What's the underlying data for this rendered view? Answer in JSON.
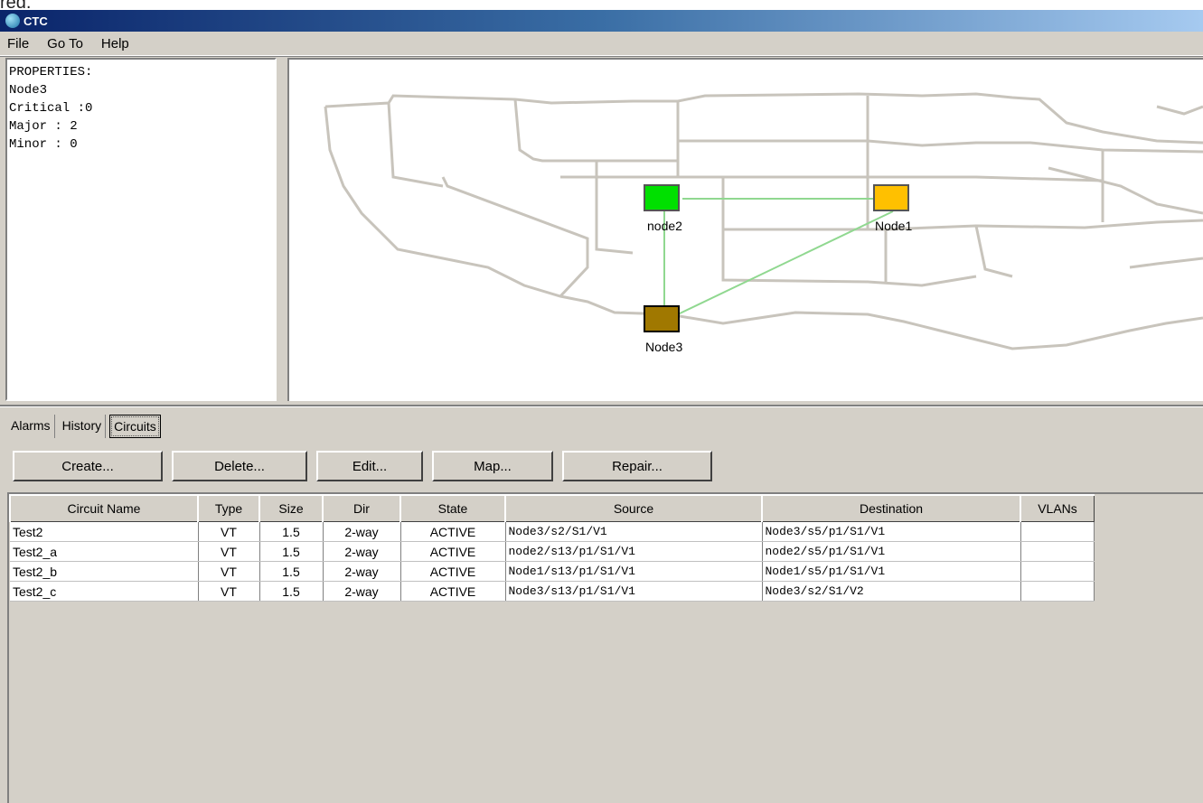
{
  "window": {
    "title": "CTC"
  },
  "top_fragment": "red.",
  "menu": [
    "File",
    "Go To",
    "Help"
  ],
  "properties": {
    "lines": [
      "PROPERTIES:",
      "Node3",
      "Critical :0",
      "Major : 2",
      "Minor : 0"
    ]
  },
  "map": {
    "nodes": [
      {
        "label": "node2",
        "color": "#00e000"
      },
      {
        "label": "Node1",
        "color": "#ffc000"
      },
      {
        "label": "Node3",
        "color": "#a07800"
      }
    ],
    "link_color": "#90d890",
    "map_line_color": "#c8c4bc"
  },
  "tabs": [
    "Alarms",
    "History",
    "Circuits"
  ],
  "active_tab": "Circuits",
  "buttons": [
    "Create...",
    "Delete...",
    "Edit...",
    "Map...",
    "Repair..."
  ],
  "table": {
    "columns": [
      "Circuit Name",
      "Type",
      "Size",
      "Dir",
      "State",
      "Source",
      "Destination",
      "VLANs"
    ],
    "rows": [
      [
        "Test2",
        "VT",
        "1.5",
        "2-way",
        "ACTIVE",
        "Node3/s2/S1/V1",
        "Node3/s5/p1/S1/V1",
        ""
      ],
      [
        "Test2_a",
        "VT",
        "1.5",
        "2-way",
        "ACTIVE",
        "node2/s13/p1/S1/V1",
        "node2/s5/p1/S1/V1",
        ""
      ],
      [
        "Test2_b",
        "VT",
        "1.5",
        "2-way",
        "ACTIVE",
        "Node1/s13/p1/S1/V1",
        "Node1/s5/p1/S1/V1",
        ""
      ],
      [
        "Test2_c",
        "VT",
        "1.5",
        "2-way",
        "ACTIVE",
        "Node3/s13/p1/S1/V1",
        "Node3/s2/S1/V2",
        ""
      ]
    ]
  }
}
